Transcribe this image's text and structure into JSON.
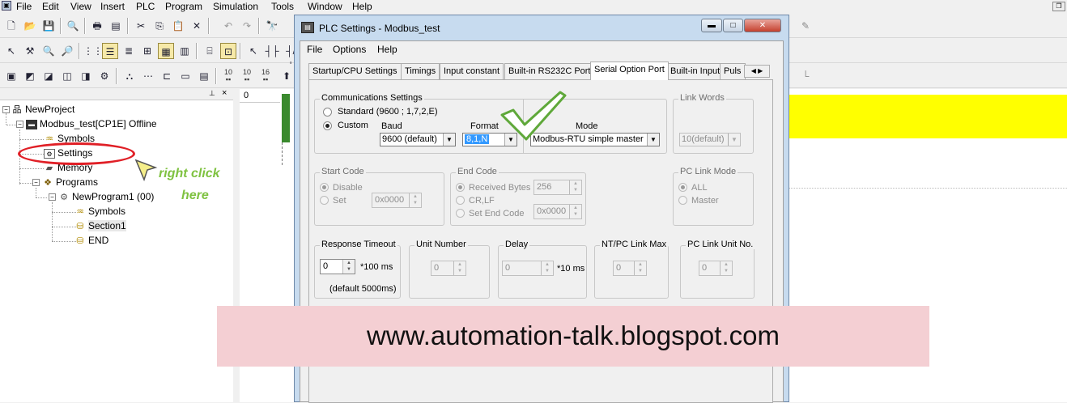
{
  "menubar": {
    "items": [
      "File",
      "Edit",
      "View",
      "Insert",
      "PLC",
      "Program",
      "Simulation",
      "Tools",
      "Window",
      "Help"
    ]
  },
  "toolbar": {
    "row3_numbers": [
      "10",
      "10",
      "16"
    ]
  },
  "ladder": {
    "rung_number": "0"
  },
  "tree": {
    "items": [
      {
        "label": "NewProject",
        "icon": "network-icon"
      },
      {
        "label": "Modbus_test[CP1E] Offline",
        "icon": "plc-icon"
      },
      {
        "label": "Symbols",
        "icon": "symbols-icon"
      },
      {
        "label": "Settings",
        "icon": "settings-icon"
      },
      {
        "label": "Memory",
        "icon": "memory-icon"
      },
      {
        "label": "Programs",
        "icon": "programs-icon"
      },
      {
        "label": "NewProgram1 (00)",
        "icon": "program-icon"
      },
      {
        "label": "Symbols",
        "icon": "symbols-icon"
      },
      {
        "label": "Section1",
        "icon": "section-icon"
      },
      {
        "label": "END",
        "icon": "section-icon"
      }
    ]
  },
  "annotation": {
    "line1": "right click",
    "line2": "here"
  },
  "dialog": {
    "title": "PLC Settings - Modbus_test",
    "menu": [
      "File",
      "Options",
      "Help"
    ],
    "tabs": [
      "Startup/CPU Settings",
      "Timings",
      "Input constant",
      "Built-in RS232C Port",
      "Serial Option Port",
      "Built-in Input",
      "Puls"
    ],
    "active_tab": "Serial Option Port",
    "comm": {
      "title": "Communications Settings",
      "standard_label": "Standard (9600 ; 1,7,2,E)",
      "custom_label": "Custom",
      "selected": "Custom",
      "baud_label": "Baud",
      "baud_value": "9600 (default)",
      "format_label": "Format",
      "format_value": "8,1,N",
      "mode_label": "Mode",
      "mode_value": "Modbus-RTU simple master"
    },
    "link_words": {
      "title": "Link Words",
      "value": "10(default)"
    },
    "start_code": {
      "title": "Start Code",
      "disable_label": "Disable",
      "set_label": "Set",
      "value": "0x0000"
    },
    "end_code": {
      "title": "End Code",
      "received_label": "Received Bytes",
      "received_value": "256",
      "crlf_label": "CR,LF",
      "set_label": "Set End Code",
      "value": "0x0000"
    },
    "pc_link_mode": {
      "title": "PC Link Mode",
      "all_label": "ALL",
      "master_label": "Master"
    },
    "response_timeout": {
      "title": "Response Timeout",
      "value": "0",
      "unit": "*100 ms",
      "default_note": "(default 5000ms)"
    },
    "unit_number": {
      "title": "Unit Number",
      "value": "0"
    },
    "delay": {
      "title": "Delay",
      "value": "0",
      "unit": "*10 ms"
    },
    "nt_pc_link_max": {
      "title": "NT/PC Link Max",
      "value": "0"
    },
    "pc_link_unit_no": {
      "title": "PC Link Unit No.",
      "value": "0"
    }
  },
  "banner": {
    "text": "www.automation-talk.blogspot.com"
  },
  "colors": {
    "rung_highlight": "#ffff00",
    "banner_bg": "#f4cfd3",
    "annotation_green": "#7fc241",
    "annotation_red": "#e01f26",
    "selection_blue": "#3399ff"
  }
}
